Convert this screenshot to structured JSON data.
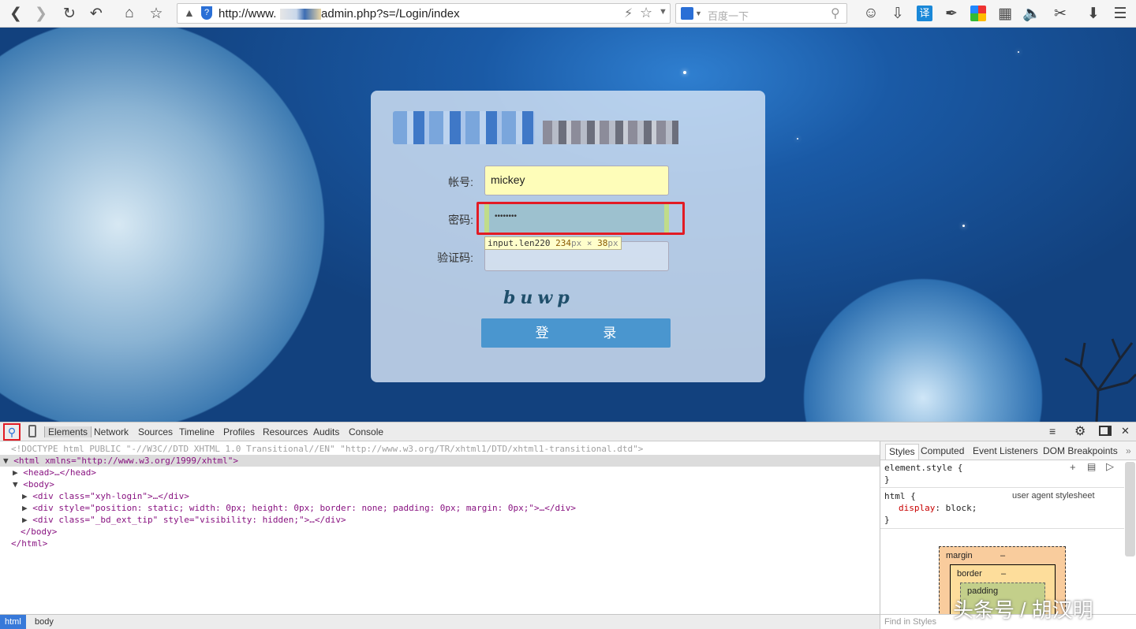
{
  "browser": {
    "url": "http://www.       .com/miadmin.php?s=/Login/index",
    "search_placeholder": "百度一下"
  },
  "login": {
    "username_label": "帐号:",
    "username_value": "mickey",
    "password_label": "密码:",
    "password_value": "••••••••",
    "captcha_label": "验证码:",
    "captcha_text": "buwp",
    "submit_label": "登 录",
    "tooltip": {
      "selector": "input.len220",
      "width": "234",
      "height": "38",
      "px": "px",
      "times": "×"
    }
  },
  "devtools": {
    "tabs": [
      "Elements",
      "Network",
      "Sources",
      "Timeline",
      "Profiles",
      "Resources",
      "Audits",
      "Console"
    ],
    "dom_lines": [
      "<!DOCTYPE html PUBLIC \"-//W3C//DTD XHTML 1.0 Transitional//EN\" \"http://www.w3.org/TR/xhtml1/DTD/xhtml1-transitional.dtd\">",
      "<html xmlns=\"http://www.w3.org/1999/xhtml\">",
      "<head>…</head>",
      "<body>",
      "<div class=\"xyh-login\">…</div>",
      "<div style=\"position: static; width: 0px; height: 0px; border: none; padding: 0px; margin: 0px;\">…</div>",
      "<div class=\"_bd_ext_tip\" style=\"visibility: hidden;\">…</div>",
      "</body>",
      "</html>"
    ],
    "styles_tabs": [
      "Styles",
      "Computed",
      "Event Listeners",
      "DOM Breakpoints"
    ],
    "styles": {
      "element_style": "element.style {",
      "close": "}",
      "html_rule": "html {",
      "source": "user agent stylesheet",
      "prop": "display",
      "value": "block"
    },
    "box_model": {
      "margin": "margin",
      "border": "border",
      "padding": "padding",
      "dash": "–"
    },
    "find_placeholder": "Find in Styles",
    "breadcrumbs": [
      "html",
      "body"
    ]
  },
  "watermark": "头条号 / 胡汉明"
}
